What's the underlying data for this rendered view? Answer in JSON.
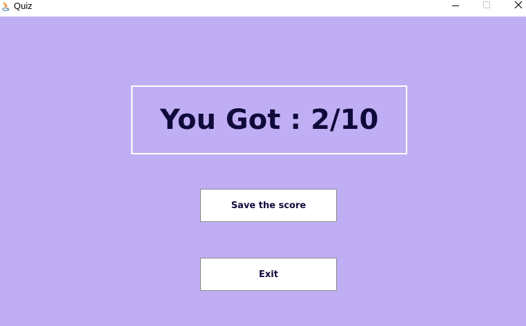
{
  "window": {
    "title": "Quiz",
    "icon": "java-coffee-icon",
    "controls": [
      "minimize-icon",
      "maximize-icon",
      "close-icon"
    ]
  },
  "result": {
    "text": "You Got : 2/10",
    "score": 2,
    "total": 10
  },
  "buttons": {
    "save_label": "Save the score",
    "exit_label": "Exit"
  },
  "colors": {
    "background": "#c0aef4",
    "text": "#0f0a3a",
    "panel_border": "#ffffff",
    "button_bg": "#ffffff"
  }
}
